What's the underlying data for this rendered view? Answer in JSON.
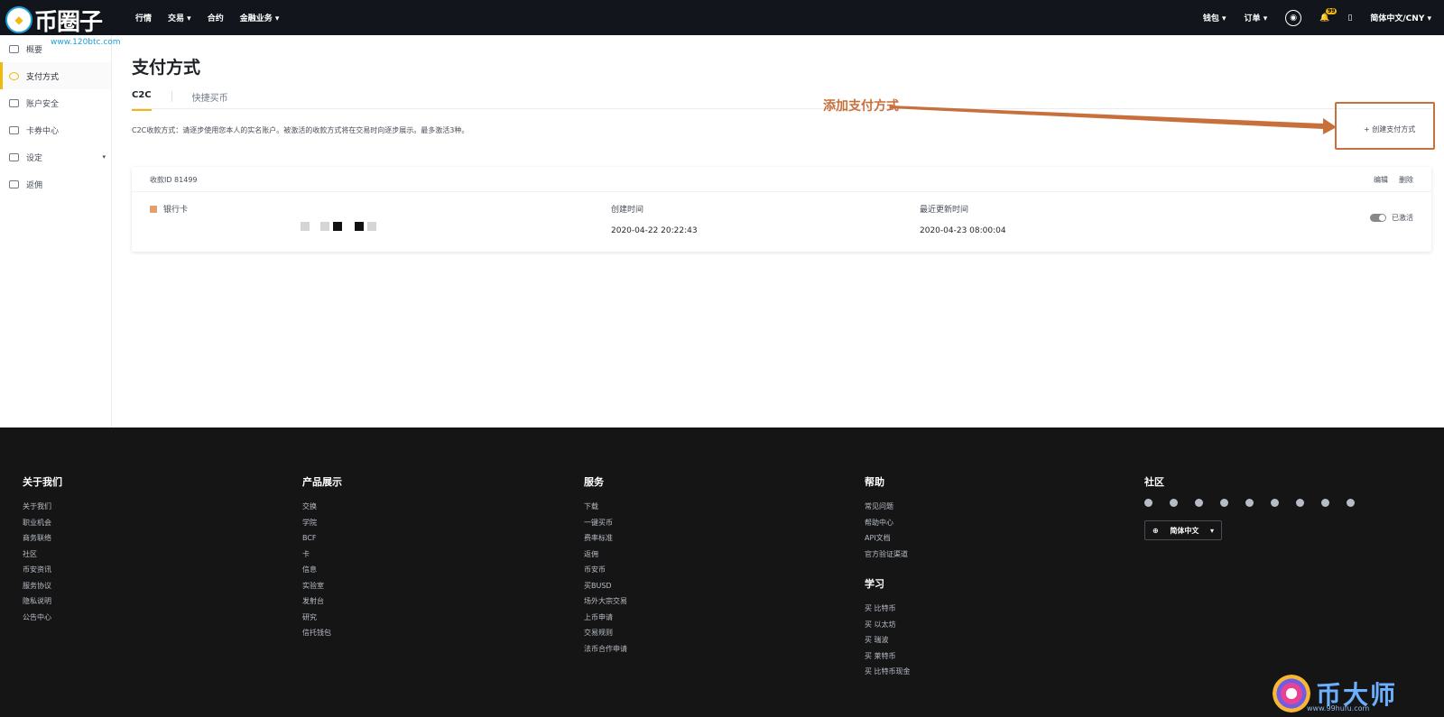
{
  "header": {
    "logo_text": "币圈子",
    "logo_sub": "www.120btc.com",
    "nav": [
      "行情",
      "交易",
      "合约",
      "金融业务"
    ],
    "right": {
      "wallet": "钱包",
      "orders": "订单",
      "notif_count": "99",
      "lang": "简体中文/CNY"
    }
  },
  "sidebar": {
    "items": [
      {
        "label": "概要",
        "icon": "overview-icon"
      },
      {
        "label": "支付方式",
        "icon": "payment-icon"
      },
      {
        "label": "账户安全",
        "icon": "security-icon"
      },
      {
        "label": "卡券中心",
        "icon": "coupon-icon"
      },
      {
        "label": "设定",
        "icon": "settings-icon"
      },
      {
        "label": "返佣",
        "icon": "referral-icon"
      }
    ]
  },
  "main": {
    "title": "支付方式",
    "tabs": [
      "C2C",
      "快捷买币"
    ],
    "notice": "C2C收款方式：请逐步使用您本人的实名账户。被激活的收款方式将在交易时向逐步展示。最多激活3种。",
    "annotation": "添加支付方式",
    "add_button": "+ 创建支付方式",
    "card": {
      "id_label": "收款ID 81499",
      "edit": "编辑",
      "delete": "删除",
      "type": "银行卡",
      "created_label": "创建时间",
      "created_value": "2020-04-22 20:22:43",
      "updated_label": "最近更新时间",
      "updated_value": "2020-04-23 08:00:04",
      "status": "已激活"
    }
  },
  "footer": {
    "about": {
      "title": "关于我们",
      "links": [
        "关于我们",
        "职业机会",
        "商务联络",
        "社区",
        "币安资讯",
        "服务协议",
        "隐私说明",
        "公告中心"
      ]
    },
    "products": {
      "title": "产品展示",
      "links": [
        "交换",
        "学院",
        "BCF",
        "卡",
        "信息",
        "实验室",
        "发射台",
        "研究",
        "信托钱包"
      ]
    },
    "service": {
      "title": "服务",
      "links": [
        "下载",
        "一键买币",
        "费率标准",
        "返佣",
        "币安币",
        "买BUSD",
        "场外大宗交易",
        "上币申请",
        "交易规则",
        "法币合作申请"
      ]
    },
    "help": {
      "title": "帮助",
      "links": [
        "常见问题",
        "帮助中心",
        "API文档",
        "官方验证渠道"
      ]
    },
    "learn": {
      "title": "学习",
      "links": [
        "买 比特币",
        "买 以太坊",
        "买 瑞波",
        "买 莱特币",
        "买 比特币现金"
      ]
    },
    "community": {
      "title": "社区",
      "lang": "简体中文"
    }
  },
  "watermark": {
    "text": "币大师",
    "url": "www.99hufu.com"
  }
}
